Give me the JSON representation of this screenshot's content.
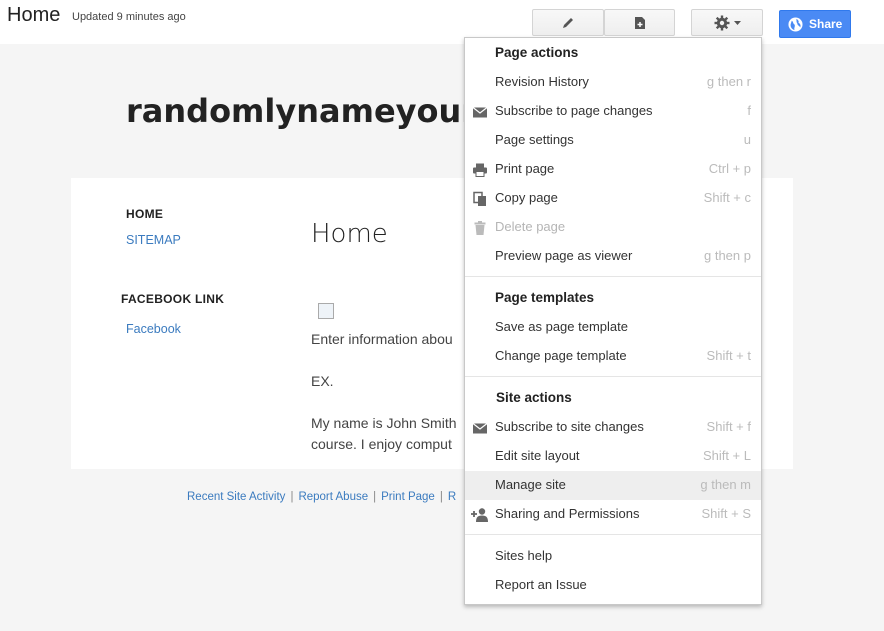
{
  "header": {
    "page_name": "Home",
    "updated": "Updated 9 minutes ago",
    "share_label": "Share"
  },
  "site": {
    "title": "randomlynameyours",
    "nav": {
      "home": "HOME",
      "sitemap": "SITEMAP",
      "facebook_heading": "FACEBOOK LINK",
      "facebook": "Facebook"
    },
    "main": {
      "heading": "Home",
      "line1": "Enter information abou",
      "line2": "EX.",
      "line3": "My name is John Smith",
      "line4": "course.  I enjoy comput"
    },
    "footer": {
      "recent_activity": "Recent Site Activity",
      "report_abuse": "Report Abuse",
      "print_page": "Print Page",
      "more": "R",
      "separator": "|"
    }
  },
  "menu": {
    "page_actions_header": "Page actions",
    "page_actions": [
      {
        "label": "Revision History",
        "shortcut": "g then r",
        "icon": "none"
      },
      {
        "label": "Subscribe to page changes",
        "shortcut": "f",
        "icon": "envelope-icon"
      },
      {
        "label": "Page settings",
        "shortcut": "u",
        "icon": "none"
      },
      {
        "label": "Print page",
        "shortcut": "Ctrl + p",
        "icon": "printer-icon"
      },
      {
        "label": "Copy page",
        "shortcut": "Shift + c",
        "icon": "copy-icon"
      },
      {
        "label": "Delete page",
        "shortcut": "",
        "icon": "trash-icon",
        "disabled": true
      },
      {
        "label": "Preview page as viewer",
        "shortcut": "g then p",
        "icon": "none"
      }
    ],
    "page_templates_header": "Page templates",
    "page_templates": [
      {
        "label": "Save as page template",
        "shortcut": ""
      },
      {
        "label": "Change page template",
        "shortcut": "Shift + t"
      }
    ],
    "site_actions_header": "Site actions",
    "site_actions": [
      {
        "label": "Subscribe to site changes",
        "shortcut": "Shift + f",
        "icon": "envelope-icon"
      },
      {
        "label": "Edit site layout",
        "shortcut": "Shift + L",
        "icon": "none"
      },
      {
        "label": "Manage site",
        "shortcut": "g then m",
        "icon": "none",
        "active": true
      },
      {
        "label": "Sharing and Permissions",
        "shortcut": "Shift + S",
        "icon": "add-person-icon"
      }
    ],
    "help": [
      {
        "label": "Sites help"
      },
      {
        "label": "Report an Issue"
      }
    ]
  },
  "colors": {
    "accent_blue": "#4a8af4",
    "link_blue": "#3b7bbf",
    "menu_highlight": "#eeeeee"
  }
}
